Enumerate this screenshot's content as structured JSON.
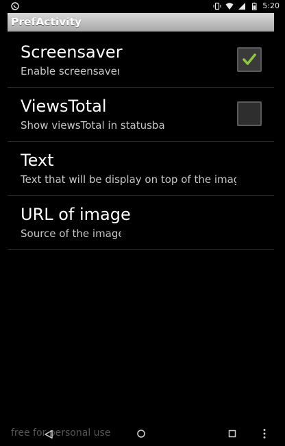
{
  "status_bar": {
    "time": "5:20",
    "icons": [
      "whatsapp-icon",
      "vibrate-icon",
      "wifi-icon",
      "signal-icon",
      "battery-icon"
    ]
  },
  "action_bar": {
    "title": "PrefActivity"
  },
  "preferences": [
    {
      "title": "Screensaver",
      "summary": "Enable screensaver",
      "checkbox": true,
      "checked": true
    },
    {
      "title": "ViewsTotal",
      "summary": "Show viewsTotal in statusba",
      "checkbox": true,
      "checked": false
    },
    {
      "title": "Text",
      "summary": "Text that will be display on top of the imag",
      "checkbox": false
    },
    {
      "title": "URL of image",
      "summary": "Source of the image",
      "checkbox": false
    }
  ],
  "colors": {
    "checkmark": "#8ec63f",
    "action_bar": "#c7c7c7",
    "background": "#000000"
  },
  "watermark": "free for personal use",
  "nav_bar": {
    "icons": [
      "back-icon",
      "home-icon",
      "recents-icon",
      "overflow-menu-icon"
    ]
  }
}
